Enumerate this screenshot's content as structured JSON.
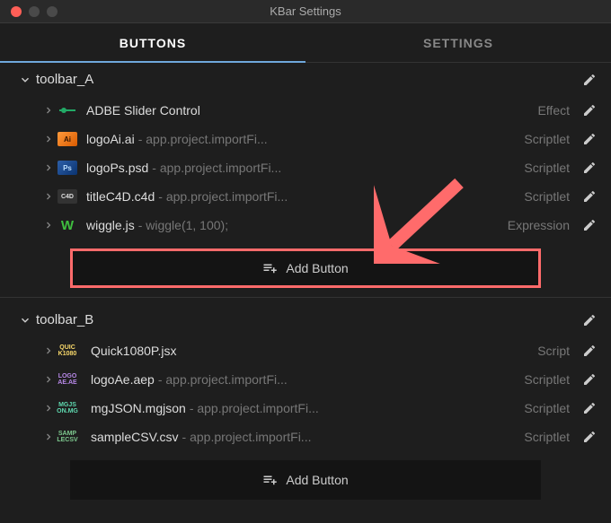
{
  "window": {
    "title": "KBar Settings"
  },
  "tabs": [
    {
      "label": "BUTTONS",
      "active": true
    },
    {
      "label": "SETTINGS",
      "active": false
    }
  ],
  "toolbars": [
    {
      "name": "toolbar_A",
      "items": [
        {
          "name": "ADBE Slider Control",
          "extra": "",
          "type": "Effect",
          "icon_kind": "slider"
        },
        {
          "name": "logoAi.ai",
          "extra": " - app.project.importFi...",
          "type": "Scriptlet",
          "icon_kind": "ai"
        },
        {
          "name": "logoPs.psd",
          "extra": " - app.project.importFi...",
          "type": "Scriptlet",
          "icon_kind": "ps"
        },
        {
          "name": "titleC4D.c4d",
          "extra": " - app.project.importFi...",
          "type": "Scriptlet",
          "icon_kind": "c4d"
        },
        {
          "name": "wiggle.js",
          "extra": " - wiggle(1, 100);",
          "type": "Expression",
          "icon_kind": "w"
        }
      ],
      "add_highlighted": true
    },
    {
      "name": "toolbar_B",
      "items": [
        {
          "name": "Quick1080P.jsx",
          "extra": "",
          "type": "Script",
          "text_icon": {
            "l1": "QUIC",
            "l2": "K1080",
            "color": "#f9d96b"
          }
        },
        {
          "name": "logoAe.aep",
          "extra": " - app.project.importFi...",
          "type": "Scriptlet",
          "text_icon": {
            "l1": "LOGO",
            "l2": "AE.AE",
            "color": "#b788e8"
          }
        },
        {
          "name": "mgJSON.mgjson",
          "extra": " - app.project.importFi...",
          "type": "Scriptlet",
          "text_icon": {
            "l1": "MGJS",
            "l2": "ON.MG",
            "color": "#5fd9b0"
          }
        },
        {
          "name": "sampleCSV.csv",
          "extra": " - app.project.importFi...",
          "type": "Scriptlet",
          "text_icon": {
            "l1": "SAMP",
            "l2": "LECSV",
            "color": "#7ec98f"
          }
        }
      ],
      "add_highlighted": false
    }
  ],
  "labels": {
    "add_button": "Add Button"
  }
}
